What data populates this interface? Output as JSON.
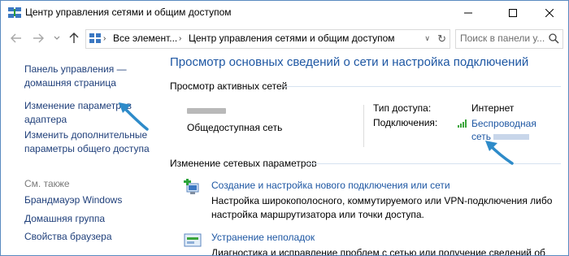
{
  "window": {
    "title": "Центр управления сетями и общим доступом"
  },
  "nav": {
    "breadcrumb": [
      "Все элемент...",
      "Центр управления сетями и общим доступом"
    ],
    "search_placeholder": "Поиск в панели у..."
  },
  "sidebar": {
    "links": [
      {
        "line1": "Панель управления —",
        "line2": "домашняя страница"
      },
      {
        "line1": "Изменение параметров",
        "line2": "адаптера"
      },
      {
        "line1": "Изменить дополнительные",
        "line2": "параметры общего доступа"
      }
    ],
    "see_also_label": "См. также",
    "see_also": [
      "Брандмауэр Windows",
      "Домашняя группа",
      "Свойства браузера"
    ]
  },
  "main": {
    "title": "Просмотр основных сведений о сети и настройка подключений",
    "active_networks_label": "Просмотр активных сетей",
    "network_type": "Общедоступная сеть",
    "access_type_label": "Тип доступа:",
    "access_type_value": "Интернет",
    "connections_label": "Подключения:",
    "connection_line1": "Беспроводная",
    "connection_line2": "сеть",
    "change_settings_label": "Изменение сетевых параметров",
    "tasks": [
      {
        "link": "Создание и настройка нового подключения или сети",
        "desc1": "Настройка широкополосного, коммутируемого или VPN-подключения либо",
        "desc2": "настройка маршрутизатора или точки доступа."
      },
      {
        "link": "Устранение неполадок",
        "desc1": "Диагностика и исправление проблем с сетью или получение сведений об",
        "desc2": ""
      }
    ]
  },
  "colors": {
    "link": "#1e57a3",
    "sidebar_link": "#1f3f7a",
    "annotation_arrow": "#2e8bc9"
  }
}
